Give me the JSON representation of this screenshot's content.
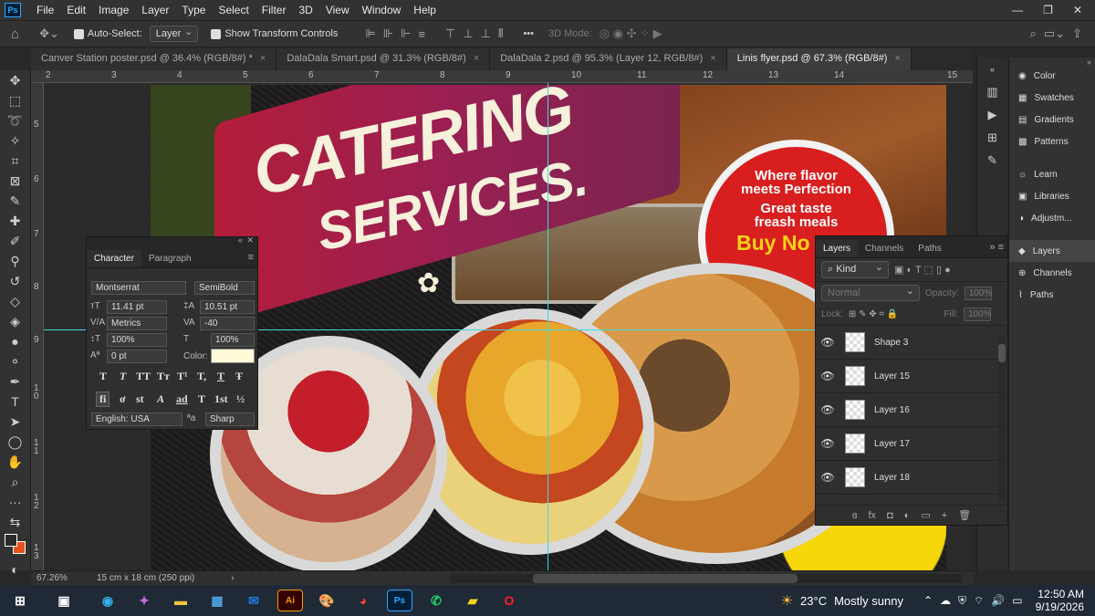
{
  "menubar": {
    "logo": "Ps",
    "items": [
      "File",
      "Edit",
      "Image",
      "Layer",
      "Type",
      "Select",
      "Filter",
      "3D",
      "View",
      "Window",
      "Help"
    ],
    "window_controls": {
      "minimize": "—",
      "maximize": "❐",
      "close": "✕"
    }
  },
  "options": {
    "auto_select_label": "Auto-Select:",
    "auto_select_value": "Layer",
    "show_transform_label": "Show Transform Controls",
    "mode_3d_label": "3D Mode:",
    "more": "•••"
  },
  "tabs": [
    {
      "label": "Canver Station poster.psd @ 36.4% (RGB/8#) *",
      "close": "×"
    },
    {
      "label": "DalaDala Smart.psd @ 31.3% (RGB/8#)",
      "close": "×"
    },
    {
      "label": "DalaDala 2.psd @ 95.3% (Layer 12, RGB/8#)",
      "close": "×"
    },
    {
      "label": "Linis flyer.psd @ 67.3% (RGB/8#)",
      "close": "×"
    }
  ],
  "active_tab": 3,
  "ruler_h": [
    "2",
    "3",
    "4",
    "5",
    "6",
    "7",
    "8",
    "9",
    "10",
    "11",
    "12",
    "13",
    "14",
    "15"
  ],
  "ruler_v": [
    "5",
    "6",
    "7",
    "8",
    "9",
    "1 0",
    "1 1",
    "1 2",
    "1 3"
  ],
  "artwork": {
    "headline1": "CATERING",
    "headline2": "SERVICES.",
    "badge_line1": "Where flavor",
    "badge_line2": "meets Perfection",
    "badge_line3": "Great taste",
    "badge_line4": "freash meals",
    "badge_cta": "Buy No"
  },
  "character_panel": {
    "tab_character": "Character",
    "tab_paragraph": "Paragraph",
    "font_family": "Montserrat",
    "font_style": "SemiBold",
    "font_size": "11.41 pt",
    "leading": "10.51 pt",
    "kerning": "Metrics",
    "tracking": "-40",
    "vscale": "100%",
    "hscale": "100%",
    "baseline": "0 pt",
    "color_label": "Color:",
    "color_value": "#fffbd6",
    "language": "English: USA",
    "aa_label": "ªa",
    "antialias": "Sharp",
    "row1": [
      "T",
      "T",
      "TT",
      "Tт",
      "T¹",
      "T,",
      "T",
      "Ŧ"
    ],
    "row2": [
      "fi",
      "ơ",
      "st",
      "A",
      "ad",
      "T",
      "1st",
      "½"
    ]
  },
  "layers_panel": {
    "tabs": [
      "Layers",
      "Channels",
      "Paths"
    ],
    "kind_label": "Kind",
    "blend_mode": "Normal",
    "opacity_label": "Opacity:",
    "opacity": "100%",
    "lock_label": "Lock:",
    "fill_label": "Fill:",
    "fill": "100%",
    "layers": [
      "Shape 3",
      "Layer 15",
      "Layer 16",
      "Layer 17",
      "Layer 18"
    ],
    "footer_icons": [
      "ɞ",
      "fx",
      "◘",
      "◐",
      "▭",
      "+",
      "🗑"
    ]
  },
  "right_panel": {
    "group1": [
      "Color",
      "Swatches",
      "Gradients",
      "Patterns"
    ],
    "group2": [
      "Learn",
      "Libraries",
      "Adjustm..."
    ],
    "group3": [
      "Layers",
      "Channels",
      "Paths"
    ]
  },
  "status": {
    "zoom": "67.26%",
    "doc_info": "15 cm x 18 cm (250 ppi)"
  },
  "taskbar": {
    "weather_temp": "23°C",
    "weather_text": "Mostly sunny",
    "time": "12:50 AM",
    "date": "9/19/2026"
  }
}
